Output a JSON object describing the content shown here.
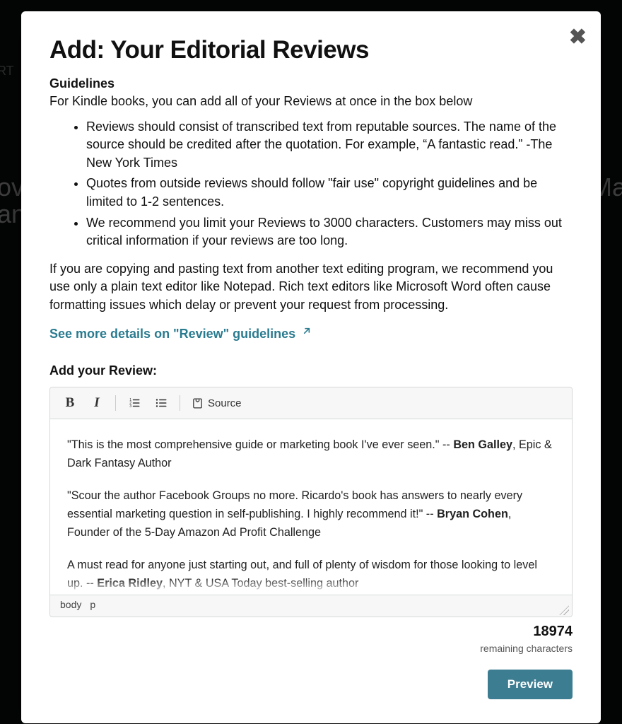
{
  "modal": {
    "title": "Add: Your Editorial Reviews",
    "guidelines_heading": "Guidelines",
    "guidelines_intro": "For Kindle books, you can add all of your Reviews at once in the box below",
    "bullets": [
      "Reviews should consist of transcribed text from reputable sources. The name of the source should be credited after the quotation. For example, “A fantastic read.” -The New York Times",
      "Quotes from outside reviews should follow \"fair use\" copyright guidelines and be limited to 1-2 sentences.",
      "We recommend you limit your Reviews to 3000 characters. Customers may miss out critical information if your reviews are too long."
    ],
    "plain_text_note": "If you are copying and pasting text from another text editing program, we recommend you use only a plain text editor like Notepad. Rich text editors like Microsoft Word often cause formatting issues which delay or prevent your request from processing.",
    "see_more_link": "See more details on \"Review\" guidelines",
    "add_label": "Add your Review:"
  },
  "toolbar": {
    "bold": "B",
    "italic": "I",
    "source_label": "Source"
  },
  "editor": {
    "quote1_pre": "\"This is the most comprehensive guide or marketing book I've ever seen.\" -- ",
    "quote1_name": "Ben Galley",
    "quote1_post": ", Epic & Dark Fantasy Author",
    "quote2_pre": "\"Scour the author Facebook Groups no more. Ricardo's book has answers to nearly every essential marketing question in self-publishing. I highly recommend it!\" -- ",
    "quote2_name": "Bryan Cohen",
    "quote2_post": ", Founder of the 5-Day Amazon Ad Profit Challenge",
    "quote3_pre": "A must read for anyone just starting out, and full of plenty of wisdom for those looking to level up. -- ",
    "quote3_name": "Erica Ridley",
    "quote3_post": ", NYT & USA Today best-selling author",
    "path_body": "body",
    "path_p": "p"
  },
  "counter": {
    "remaining": "18974",
    "label": "remaining characters"
  },
  "actions": {
    "preview": "Preview"
  }
}
